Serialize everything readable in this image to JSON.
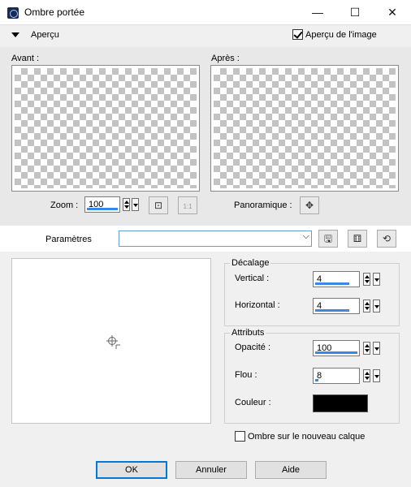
{
  "window": {
    "title": "Ombre portée",
    "minimize_glyph": "—",
    "maximize_glyph": "☐",
    "close_glyph": "✕"
  },
  "preview": {
    "section_label": "Aperçu",
    "image_preview_label": "Aperçu de l'image",
    "image_preview_checked": true,
    "before_label": "Avant :",
    "after_label": "Après :",
    "zoom_label": "Zoom :",
    "zoom_value": "100",
    "panoramic_label": "Panoramique :",
    "actual_size_label": "1:1"
  },
  "presets": {
    "label": "Paramètres",
    "value": ""
  },
  "offset": {
    "group_label": "Décalage",
    "vertical_label": "Vertical :",
    "vertical_value": "4",
    "horizontal_label": "Horizontal :",
    "horizontal_value": "4"
  },
  "attributes": {
    "group_label": "Attributs",
    "opacity_label": "Opacité :",
    "opacity_value": "100",
    "blur_label": "Flou :",
    "blur_value": "8",
    "color_label": "Couleur :",
    "color_value": "#000000"
  },
  "new_layer": {
    "label": "Ombre sur le nouveau calque",
    "checked": false
  },
  "buttons": {
    "ok": "OK",
    "cancel": "Annuler",
    "help": "Aide"
  },
  "colors": {
    "accent": "#0078d7",
    "field_bar": "#3b87e6"
  }
}
